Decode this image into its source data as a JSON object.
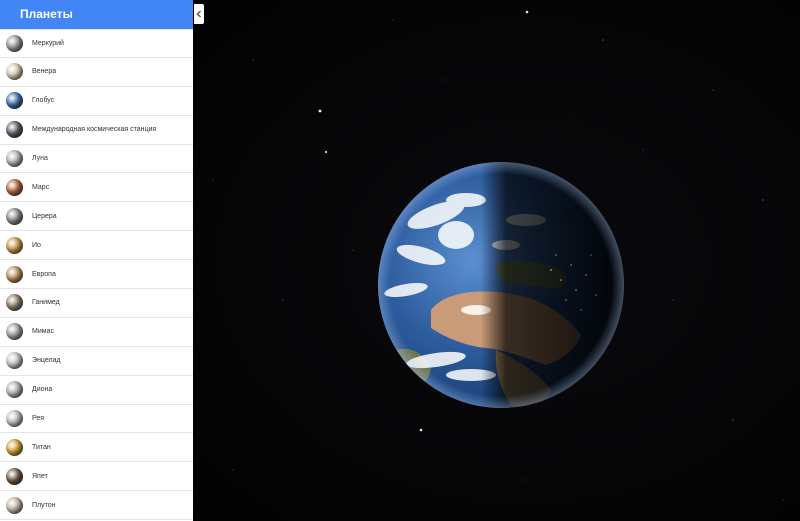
{
  "sidebar": {
    "title": "Планеты",
    "items": [
      {
        "label": "Меркурий",
        "icon": "mercury-icon",
        "color": "#9a9a96"
      },
      {
        "label": "Венера",
        "icon": "venus-icon",
        "color": "#d8cfb4"
      },
      {
        "label": "Глобус",
        "icon": "earth-icon",
        "color": "#3f6fae"
      },
      {
        "label": "Международная космическая станция",
        "icon": "iss-icon",
        "color": "#58606a"
      },
      {
        "label": "Луна",
        "icon": "moon-icon",
        "color": "#b8b6b2"
      },
      {
        "label": "Марс",
        "icon": "mars-icon",
        "color": "#b3673d"
      },
      {
        "label": "Церера",
        "icon": "ceres-icon",
        "color": "#8e8c88"
      },
      {
        "label": "Ио",
        "icon": "io-icon",
        "color": "#c89a4a"
      },
      {
        "label": "Европа",
        "icon": "europa-icon",
        "color": "#b9935e"
      },
      {
        "label": "Ганимед",
        "icon": "ganymede-icon",
        "color": "#8d7f6c"
      },
      {
        "label": "Мимас",
        "icon": "mimas-icon",
        "color": "#a4a4a2"
      },
      {
        "label": "Энцелад",
        "icon": "enceladus-icon",
        "color": "#c4c8cc"
      },
      {
        "label": "Диона",
        "icon": "dione-icon",
        "color": "#b6b6b4"
      },
      {
        "label": "Рея",
        "icon": "rhea-icon",
        "color": "#c2c2c0"
      },
      {
        "label": "Титан",
        "icon": "titan-icon",
        "color": "#d3a43b"
      },
      {
        "label": "Япет",
        "icon": "iapetus-icon",
        "color": "#6f5a44"
      },
      {
        "label": "Плутон",
        "icon": "pluto-icon",
        "color": "#c7b8a8"
      }
    ]
  },
  "colors": {
    "header": "#4285f4",
    "space": "#050506"
  }
}
